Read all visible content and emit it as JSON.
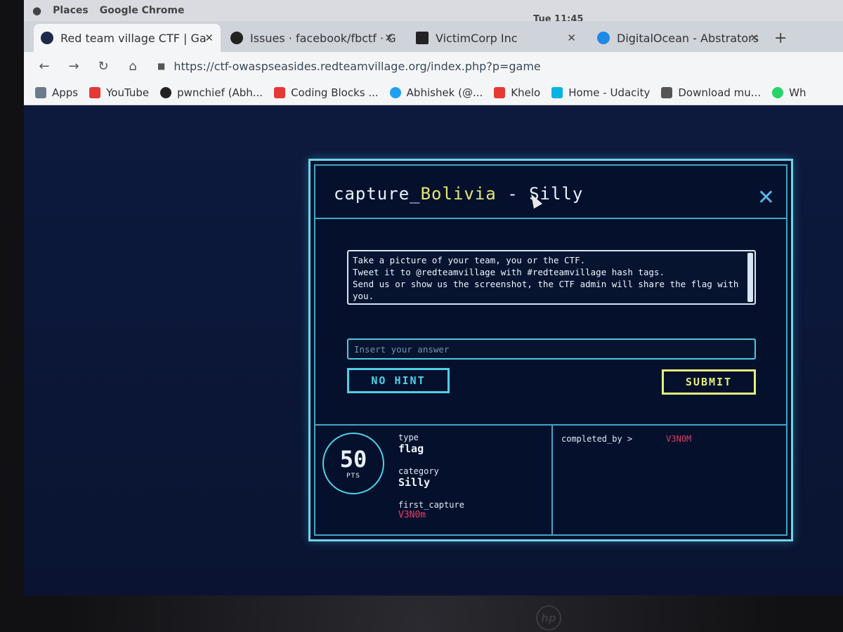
{
  "menubar": {
    "places": "Places",
    "app": "Google Chrome",
    "clock": "Tue 11:45"
  },
  "tabs": [
    {
      "title": "Red team village CTF | Ga",
      "icon_color": "#1b2a4a",
      "active": true
    },
    {
      "title": "Issues · facebook/fbctf · G",
      "icon_color": "#222222",
      "active": false
    },
    {
      "title": "VictimCorp Inc",
      "icon_color": "#222222",
      "active": false
    },
    {
      "title": "DigitalOcean - Abstrators",
      "icon_color": "#1e88e5",
      "active": false
    }
  ],
  "toolbar": {
    "url": "https://ctf-owaspseasides.redteamvillage.org/index.php?p=game"
  },
  "bookmarks": [
    {
      "label": "Apps",
      "color": "#6b7b8b"
    },
    {
      "label": "YouTube",
      "color": "#e53935"
    },
    {
      "label": "pwnchief (Abh...",
      "color": "#222222"
    },
    {
      "label": "Coding Blocks ...",
      "color": "#e53935"
    },
    {
      "label": "Abhishek (@...",
      "color": "#1da1f2"
    },
    {
      "label": "Khelo",
      "color": "#e53935"
    },
    {
      "label": "Home - Udacity",
      "color": "#02b3e4"
    },
    {
      "label": "Download mu...",
      "color": "#555555"
    },
    {
      "label": "Wh",
      "color": "#25d366"
    }
  ],
  "modal": {
    "title_prefix": "capture_",
    "title_country": "Bolivia",
    "title_suffix": " - Silly",
    "description": "Take a picture of your team, you or the CTF.\nTweet it to @redteamvillage with #redteamvillage hash tags.\nSend us or show us the screenshot, the CTF admin will share the flag with you.",
    "answer_placeholder": "Insert your answer",
    "hint_button": "NO HINT",
    "submit_button": "SUBMIT",
    "points": "50",
    "points_label": "PTS",
    "type_label": "type",
    "type_value": "flag",
    "category_label": "category",
    "category_value": "Silly",
    "first_capture_label": "first_capture",
    "first_capture_value": "V3N0m",
    "completed_by_label": "completed_by >",
    "completed_by_value": "V3N0M"
  },
  "hardware": {
    "brand": "hp"
  }
}
